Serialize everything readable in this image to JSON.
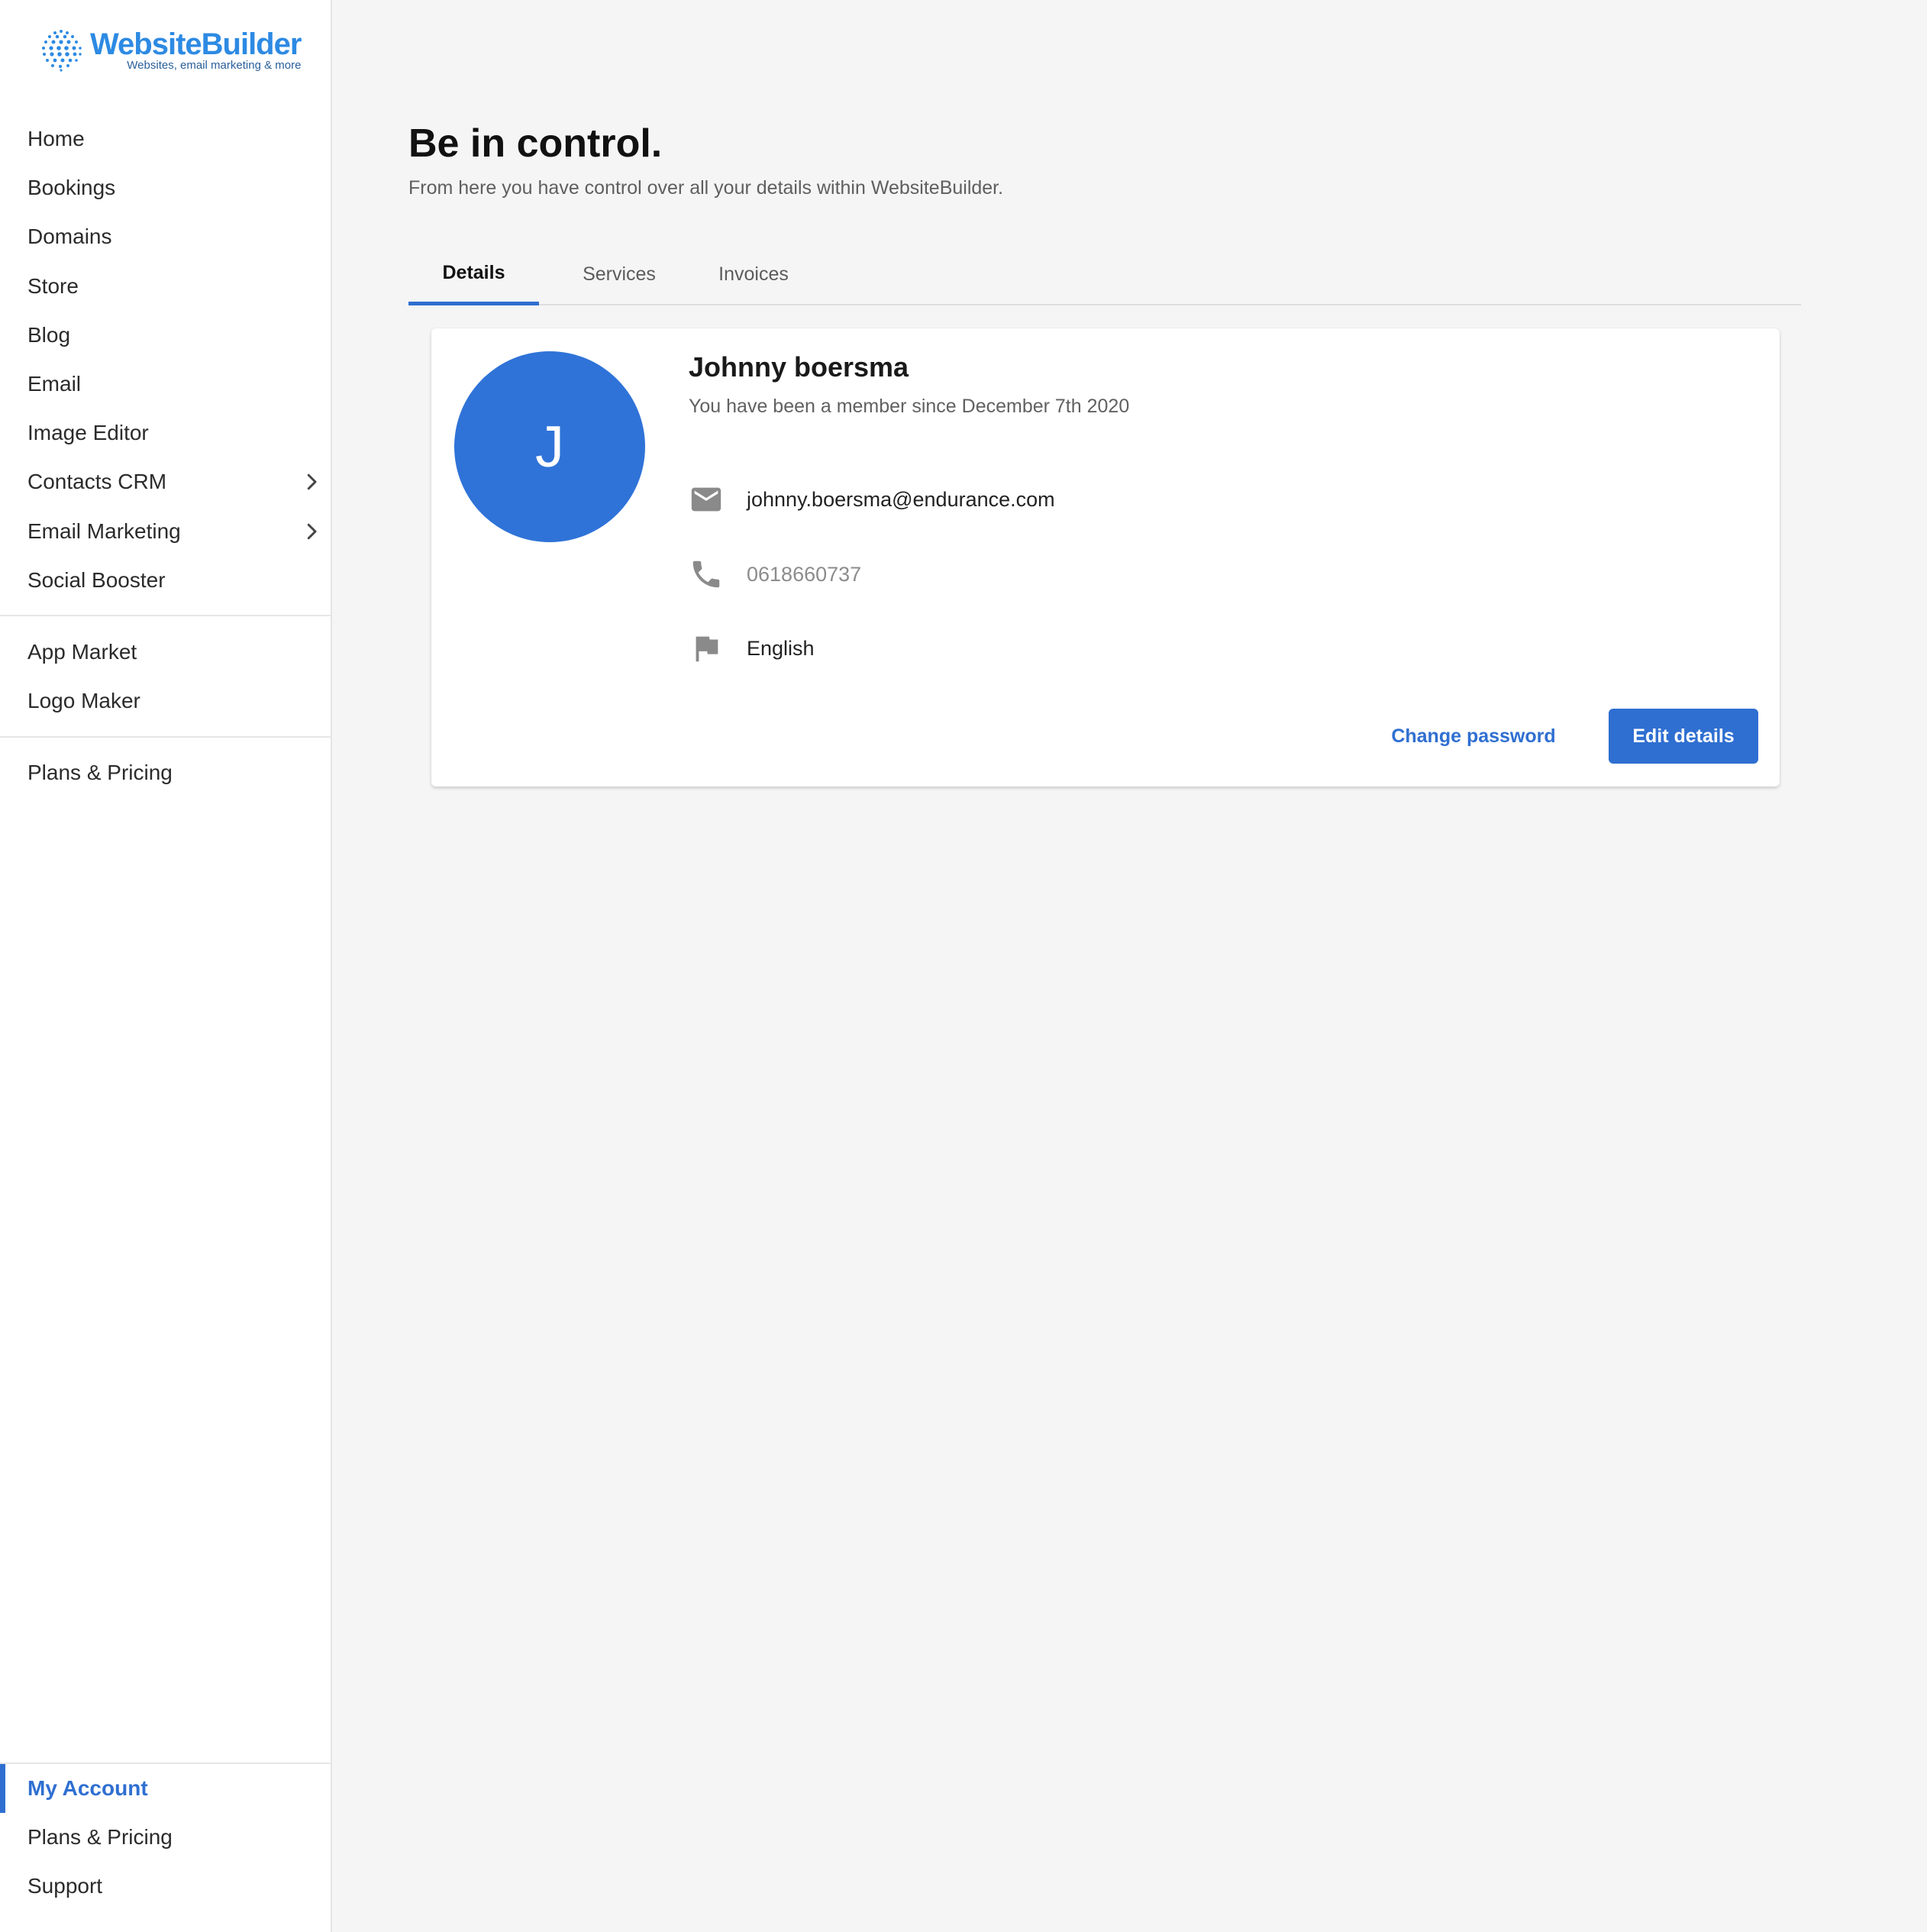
{
  "brand": {
    "name": "WebsiteBuilder",
    "tagline": "Websites, email marketing & more",
    "color": "#2d8ae3"
  },
  "sidebar": {
    "main_items": [
      {
        "label": "Home"
      },
      {
        "label": "Bookings"
      },
      {
        "label": "Domains"
      },
      {
        "label": "Store"
      },
      {
        "label": "Blog"
      },
      {
        "label": "Email"
      },
      {
        "label": "Image Editor"
      },
      {
        "label": "Contacts CRM",
        "icon": "chevron-right-icon"
      },
      {
        "label": "Email Marketing",
        "icon": "chevron-right-icon"
      },
      {
        "label": "Social Booster"
      }
    ],
    "tool_items": [
      {
        "label": "App Market"
      },
      {
        "label": "Logo Maker"
      }
    ],
    "plan_items": [
      {
        "label": "Plans & Pricing"
      }
    ],
    "bottom_items": [
      {
        "label": "My Account",
        "active": true
      },
      {
        "label": "Plans & Pricing"
      },
      {
        "label": "Support"
      }
    ]
  },
  "page": {
    "title": "Be in control.",
    "subtitle": "From here you have control over all your details within WebsiteBuilder."
  },
  "tabs": [
    {
      "label": "Details",
      "active": true
    },
    {
      "label": "Services"
    },
    {
      "label": "Invoices"
    }
  ],
  "profile": {
    "initial": "J",
    "name": "Johnny boersma",
    "member_since": "You have been a member since December 7th 2020",
    "email": "johnny.boersma@endurance.com",
    "phone": "0618660737",
    "language": "English",
    "icons": {
      "email": "mail-icon",
      "phone": "phone-icon",
      "language": "flag-icon"
    }
  },
  "actions": {
    "change_password": "Change password",
    "edit_details": "Edit details"
  },
  "colors": {
    "accent": "#2f6fd1",
    "avatar": "#2f73d8",
    "background": "#f5f5f5"
  }
}
